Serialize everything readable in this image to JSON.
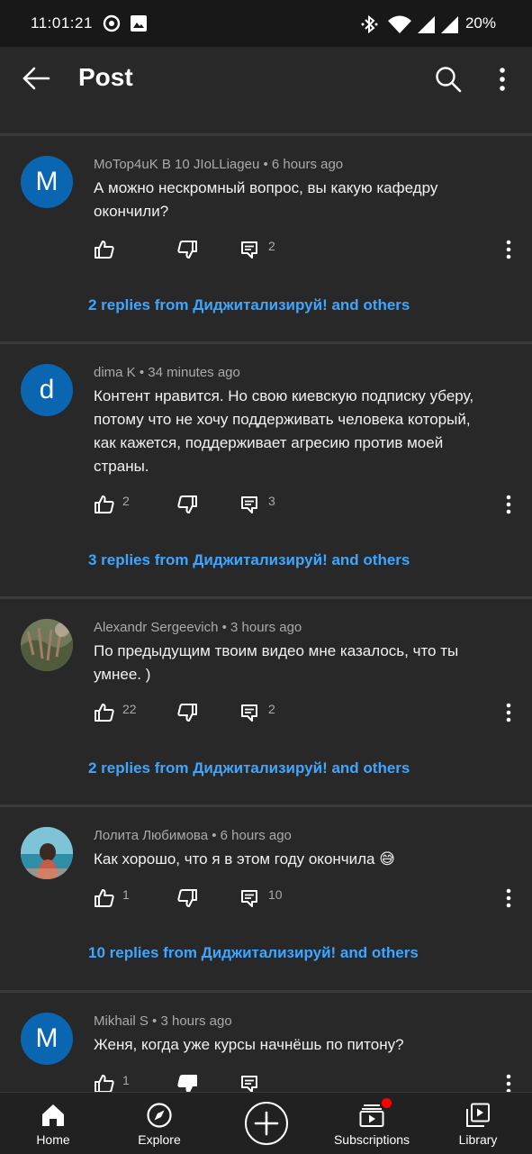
{
  "status_bar": {
    "time": "11:01:21",
    "battery": "20%"
  },
  "app_bar": {
    "title": "Post"
  },
  "comments": [
    {
      "avatar_letter": "M",
      "author": "MoTop4uK B 10 JIoLLiageu",
      "time": "6 hours ago",
      "text": "А можно нескромный вопрос, вы какую кафедру окончили?",
      "likes": "",
      "replies_count": "2",
      "replies_label": "2 replies from Диджитализируй! and others"
    },
    {
      "avatar_letter": "d",
      "author": "dima K",
      "time": "34 minutes ago",
      "text": "Контент нравится. Но свою киевскую подписку уберу, потому что не хочу поддерживать человека который, как кажется, поддерживает агресию против моей страны.",
      "likes": "2",
      "replies_count": "3",
      "replies_label": "3 replies from Диджитализируй! and others"
    },
    {
      "avatar_letter": "",
      "author": "Alexandr Sergeevich",
      "time": "3 hours ago",
      "text": "По предыдущим твоим видео мне казалось, что ты умнее. )",
      "likes": "22",
      "replies_count": "2",
      "replies_label": "2 replies from Диджитализируй! and others"
    },
    {
      "avatar_letter": "",
      "author": "Лолита Любимова",
      "time": "6 hours ago",
      "text": "Как хорошо, что я в этом году окончила 😅",
      "likes": "1",
      "replies_count": "10",
      "replies_label": "10 replies from Диджитализируй! and others"
    },
    {
      "avatar_letter": "M",
      "author": "Mikhail S",
      "time": "3 hours ago",
      "text": "Женя, когда уже курсы начнёшь по питону?",
      "likes": "1",
      "replies_count": "",
      "replies_label": ""
    }
  ],
  "separator": "•",
  "bottom_nav": {
    "home": "Home",
    "explore": "Explore",
    "subscriptions": "Subscriptions",
    "library": "Library"
  },
  "colors": {
    "background": "#282828",
    "link_blue": "#3ea6ff",
    "avatar_blue": "#0b66b2",
    "notification_red": "#ff0000"
  }
}
